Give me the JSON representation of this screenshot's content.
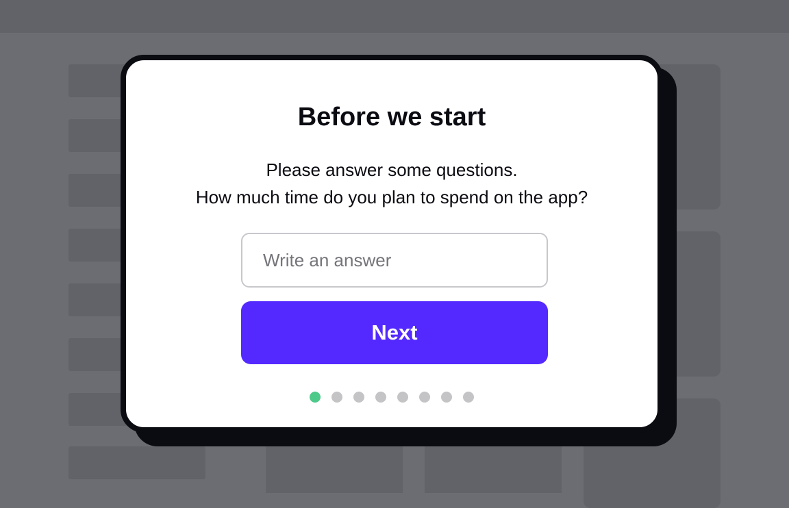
{
  "onboarding_modal": {
    "title": "Before we start",
    "description_line1": "Please answer some questions.",
    "description_line2": "How much time do you plan to spend on the app?",
    "answer_input": {
      "value": "",
      "placeholder": "Write an answer"
    },
    "next_button_label": "Next",
    "progress": {
      "current_step": 1,
      "total_steps": 8
    }
  },
  "colors": {
    "primary_button": "#5429ff",
    "active_step": "#4dc98a",
    "inactive_step": "#c4c4c6",
    "overlay_background": "#6c6d72",
    "modal_border": "#0b0b12"
  }
}
